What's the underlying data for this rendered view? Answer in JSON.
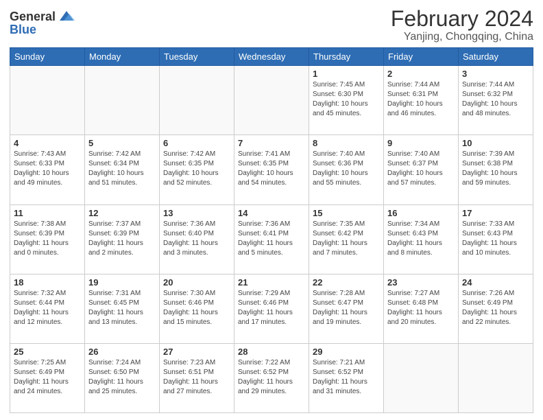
{
  "logo": {
    "general": "General",
    "blue": "Blue"
  },
  "title": "February 2024",
  "subtitle": "Yanjing, Chongqing, China",
  "days_of_week": [
    "Sunday",
    "Monday",
    "Tuesday",
    "Wednesday",
    "Thursday",
    "Friday",
    "Saturday"
  ],
  "weeks": [
    [
      {
        "day": "",
        "sunrise": "",
        "sunset": "",
        "daylight": ""
      },
      {
        "day": "",
        "sunrise": "",
        "sunset": "",
        "daylight": ""
      },
      {
        "day": "",
        "sunrise": "",
        "sunset": "",
        "daylight": ""
      },
      {
        "day": "",
        "sunrise": "",
        "sunset": "",
        "daylight": ""
      },
      {
        "day": "1",
        "sunrise": "Sunrise: 7:45 AM",
        "sunset": "Sunset: 6:30 PM",
        "daylight": "Daylight: 10 hours and 45 minutes."
      },
      {
        "day": "2",
        "sunrise": "Sunrise: 7:44 AM",
        "sunset": "Sunset: 6:31 PM",
        "daylight": "Daylight: 10 hours and 46 minutes."
      },
      {
        "day": "3",
        "sunrise": "Sunrise: 7:44 AM",
        "sunset": "Sunset: 6:32 PM",
        "daylight": "Daylight: 10 hours and 48 minutes."
      }
    ],
    [
      {
        "day": "4",
        "sunrise": "Sunrise: 7:43 AM",
        "sunset": "Sunset: 6:33 PM",
        "daylight": "Daylight: 10 hours and 49 minutes."
      },
      {
        "day": "5",
        "sunrise": "Sunrise: 7:42 AM",
        "sunset": "Sunset: 6:34 PM",
        "daylight": "Daylight: 10 hours and 51 minutes."
      },
      {
        "day": "6",
        "sunrise": "Sunrise: 7:42 AM",
        "sunset": "Sunset: 6:35 PM",
        "daylight": "Daylight: 10 hours and 52 minutes."
      },
      {
        "day": "7",
        "sunrise": "Sunrise: 7:41 AM",
        "sunset": "Sunset: 6:35 PM",
        "daylight": "Daylight: 10 hours and 54 minutes."
      },
      {
        "day": "8",
        "sunrise": "Sunrise: 7:40 AM",
        "sunset": "Sunset: 6:36 PM",
        "daylight": "Daylight: 10 hours and 55 minutes."
      },
      {
        "day": "9",
        "sunrise": "Sunrise: 7:40 AM",
        "sunset": "Sunset: 6:37 PM",
        "daylight": "Daylight: 10 hours and 57 minutes."
      },
      {
        "day": "10",
        "sunrise": "Sunrise: 7:39 AM",
        "sunset": "Sunset: 6:38 PM",
        "daylight": "Daylight: 10 hours and 59 minutes."
      }
    ],
    [
      {
        "day": "11",
        "sunrise": "Sunrise: 7:38 AM",
        "sunset": "Sunset: 6:39 PM",
        "daylight": "Daylight: 11 hours and 0 minutes."
      },
      {
        "day": "12",
        "sunrise": "Sunrise: 7:37 AM",
        "sunset": "Sunset: 6:39 PM",
        "daylight": "Daylight: 11 hours and 2 minutes."
      },
      {
        "day": "13",
        "sunrise": "Sunrise: 7:36 AM",
        "sunset": "Sunset: 6:40 PM",
        "daylight": "Daylight: 11 hours and 3 minutes."
      },
      {
        "day": "14",
        "sunrise": "Sunrise: 7:36 AM",
        "sunset": "Sunset: 6:41 PM",
        "daylight": "Daylight: 11 hours and 5 minutes."
      },
      {
        "day": "15",
        "sunrise": "Sunrise: 7:35 AM",
        "sunset": "Sunset: 6:42 PM",
        "daylight": "Daylight: 11 hours and 7 minutes."
      },
      {
        "day": "16",
        "sunrise": "Sunrise: 7:34 AM",
        "sunset": "Sunset: 6:43 PM",
        "daylight": "Daylight: 11 hours and 8 minutes."
      },
      {
        "day": "17",
        "sunrise": "Sunrise: 7:33 AM",
        "sunset": "Sunset: 6:43 PM",
        "daylight": "Daylight: 11 hours and 10 minutes."
      }
    ],
    [
      {
        "day": "18",
        "sunrise": "Sunrise: 7:32 AM",
        "sunset": "Sunset: 6:44 PM",
        "daylight": "Daylight: 11 hours and 12 minutes."
      },
      {
        "day": "19",
        "sunrise": "Sunrise: 7:31 AM",
        "sunset": "Sunset: 6:45 PM",
        "daylight": "Daylight: 11 hours and 13 minutes."
      },
      {
        "day": "20",
        "sunrise": "Sunrise: 7:30 AM",
        "sunset": "Sunset: 6:46 PM",
        "daylight": "Daylight: 11 hours and 15 minutes."
      },
      {
        "day": "21",
        "sunrise": "Sunrise: 7:29 AM",
        "sunset": "Sunset: 6:46 PM",
        "daylight": "Daylight: 11 hours and 17 minutes."
      },
      {
        "day": "22",
        "sunrise": "Sunrise: 7:28 AM",
        "sunset": "Sunset: 6:47 PM",
        "daylight": "Daylight: 11 hours and 19 minutes."
      },
      {
        "day": "23",
        "sunrise": "Sunrise: 7:27 AM",
        "sunset": "Sunset: 6:48 PM",
        "daylight": "Daylight: 11 hours and 20 minutes."
      },
      {
        "day": "24",
        "sunrise": "Sunrise: 7:26 AM",
        "sunset": "Sunset: 6:49 PM",
        "daylight": "Daylight: 11 hours and 22 minutes."
      }
    ],
    [
      {
        "day": "25",
        "sunrise": "Sunrise: 7:25 AM",
        "sunset": "Sunset: 6:49 PM",
        "daylight": "Daylight: 11 hours and 24 minutes."
      },
      {
        "day": "26",
        "sunrise": "Sunrise: 7:24 AM",
        "sunset": "Sunset: 6:50 PM",
        "daylight": "Daylight: 11 hours and 25 minutes."
      },
      {
        "day": "27",
        "sunrise": "Sunrise: 7:23 AM",
        "sunset": "Sunset: 6:51 PM",
        "daylight": "Daylight: 11 hours and 27 minutes."
      },
      {
        "day": "28",
        "sunrise": "Sunrise: 7:22 AM",
        "sunset": "Sunset: 6:52 PM",
        "daylight": "Daylight: 11 hours and 29 minutes."
      },
      {
        "day": "29",
        "sunrise": "Sunrise: 7:21 AM",
        "sunset": "Sunset: 6:52 PM",
        "daylight": "Daylight: 11 hours and 31 minutes."
      },
      {
        "day": "",
        "sunrise": "",
        "sunset": "",
        "daylight": ""
      },
      {
        "day": "",
        "sunrise": "",
        "sunset": "",
        "daylight": ""
      }
    ]
  ]
}
